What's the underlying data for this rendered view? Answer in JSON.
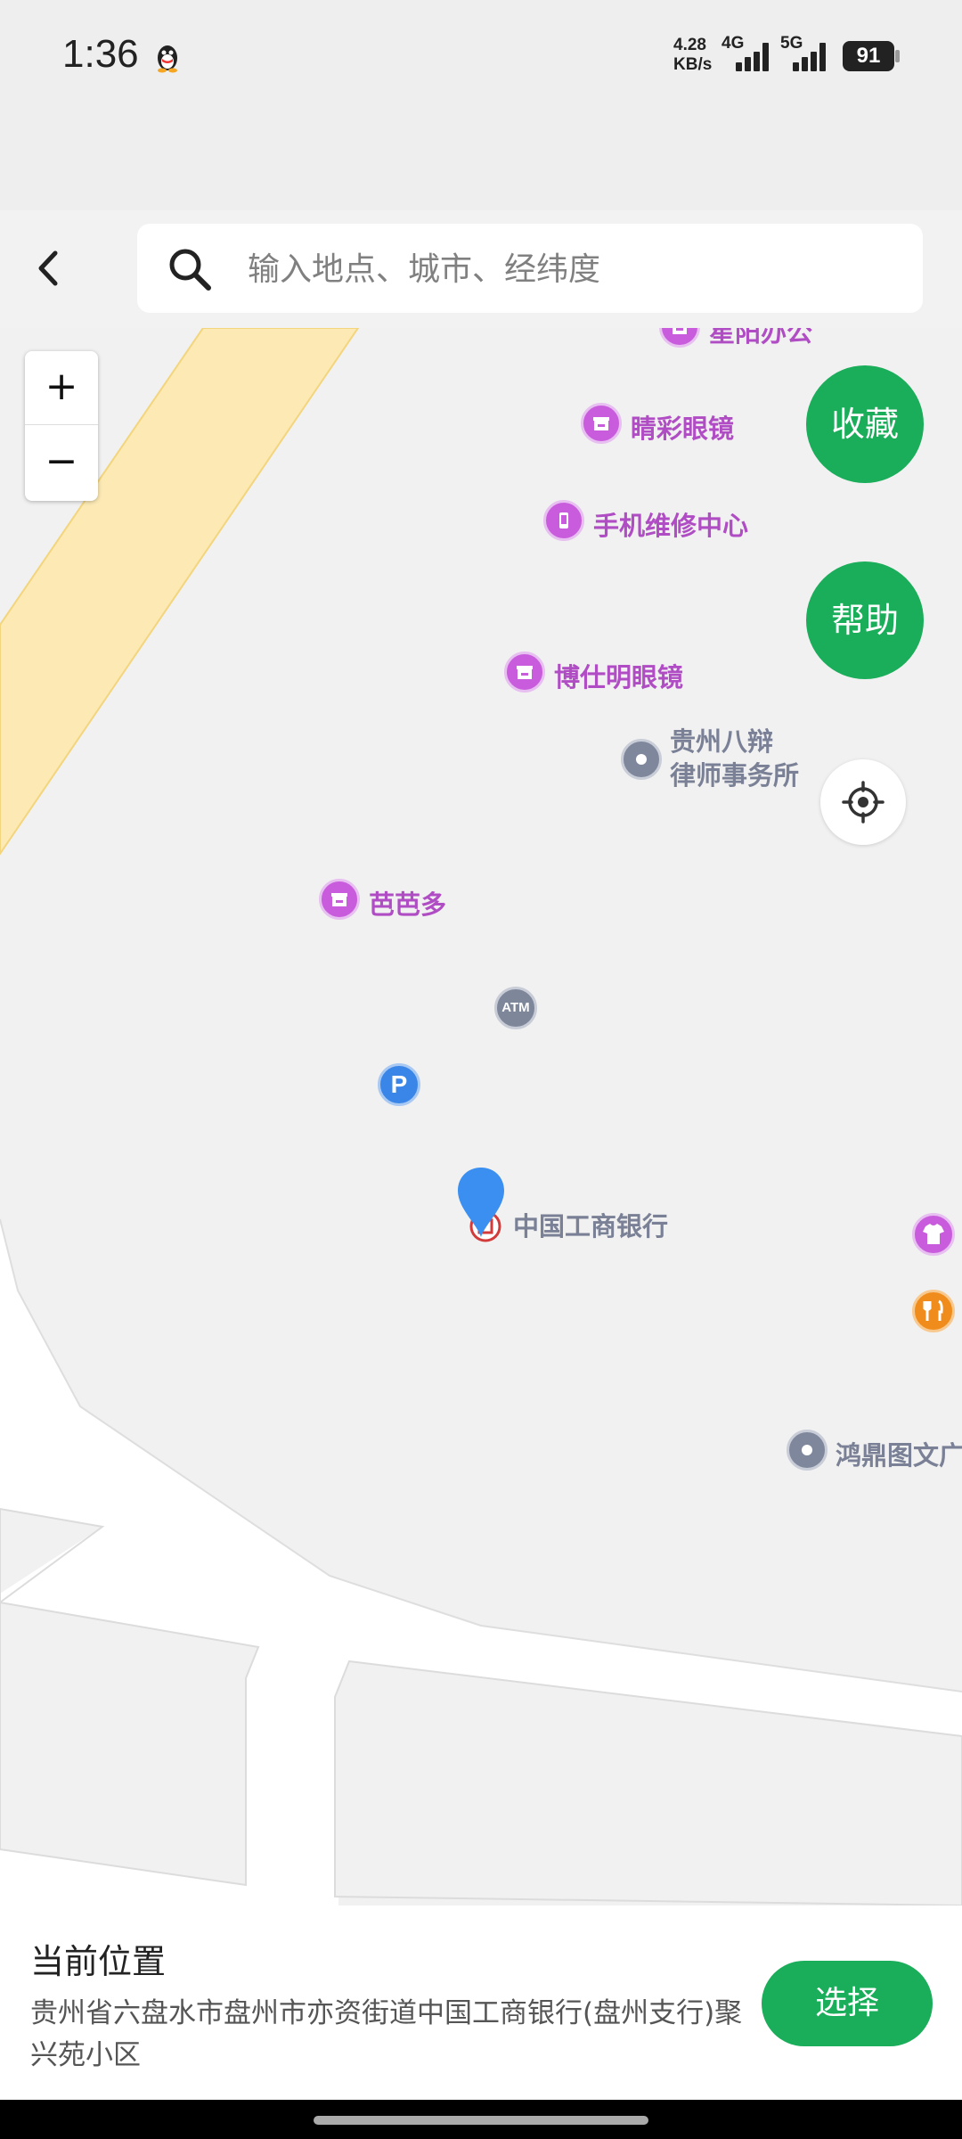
{
  "status_bar": {
    "time": "1:36",
    "network_speed_value": "4.28",
    "network_speed_unit": "KB/s",
    "sim1": "4G",
    "sim2": "5G",
    "battery": "91",
    "app_icon": "qq-penguin-icon"
  },
  "header": {
    "back_icon": "chevron-left-icon",
    "search_icon": "search-icon",
    "search_placeholder": "输入地点、城市、经纬度"
  },
  "map": {
    "zoom_in": "+",
    "zoom_out": "−",
    "favorite_label": "收藏",
    "help_label": "帮助",
    "locate_icon": "crosshair-icon",
    "selected_pin": "location-pin-icon",
    "pois": {
      "top_partial": "星阳办公",
      "glasses1": "睛彩眼镜",
      "phone_repair": "手机维修中心",
      "glasses2": "博仕明眼镜",
      "law_line1": "贵州八辩",
      "law_line2": "律师事务所",
      "babaduo": "芭芭多",
      "atm": "ATM",
      "parking": "P",
      "bank": "中国工商银行",
      "hongding": "鸿鼎图文广"
    },
    "colors": {
      "poi_purple": "#b04cc4",
      "poi_grey": "#7a8196",
      "road_yellow": "#fce9b4",
      "accent_green": "#1aad5a",
      "pin_blue": "#3a8ff0"
    }
  },
  "bottom_panel": {
    "title": "当前位置",
    "address": "贵州省六盘水市盘州市亦资街道中国工商银行(盘州支行)聚兴苑小区",
    "select_label": "选择"
  }
}
